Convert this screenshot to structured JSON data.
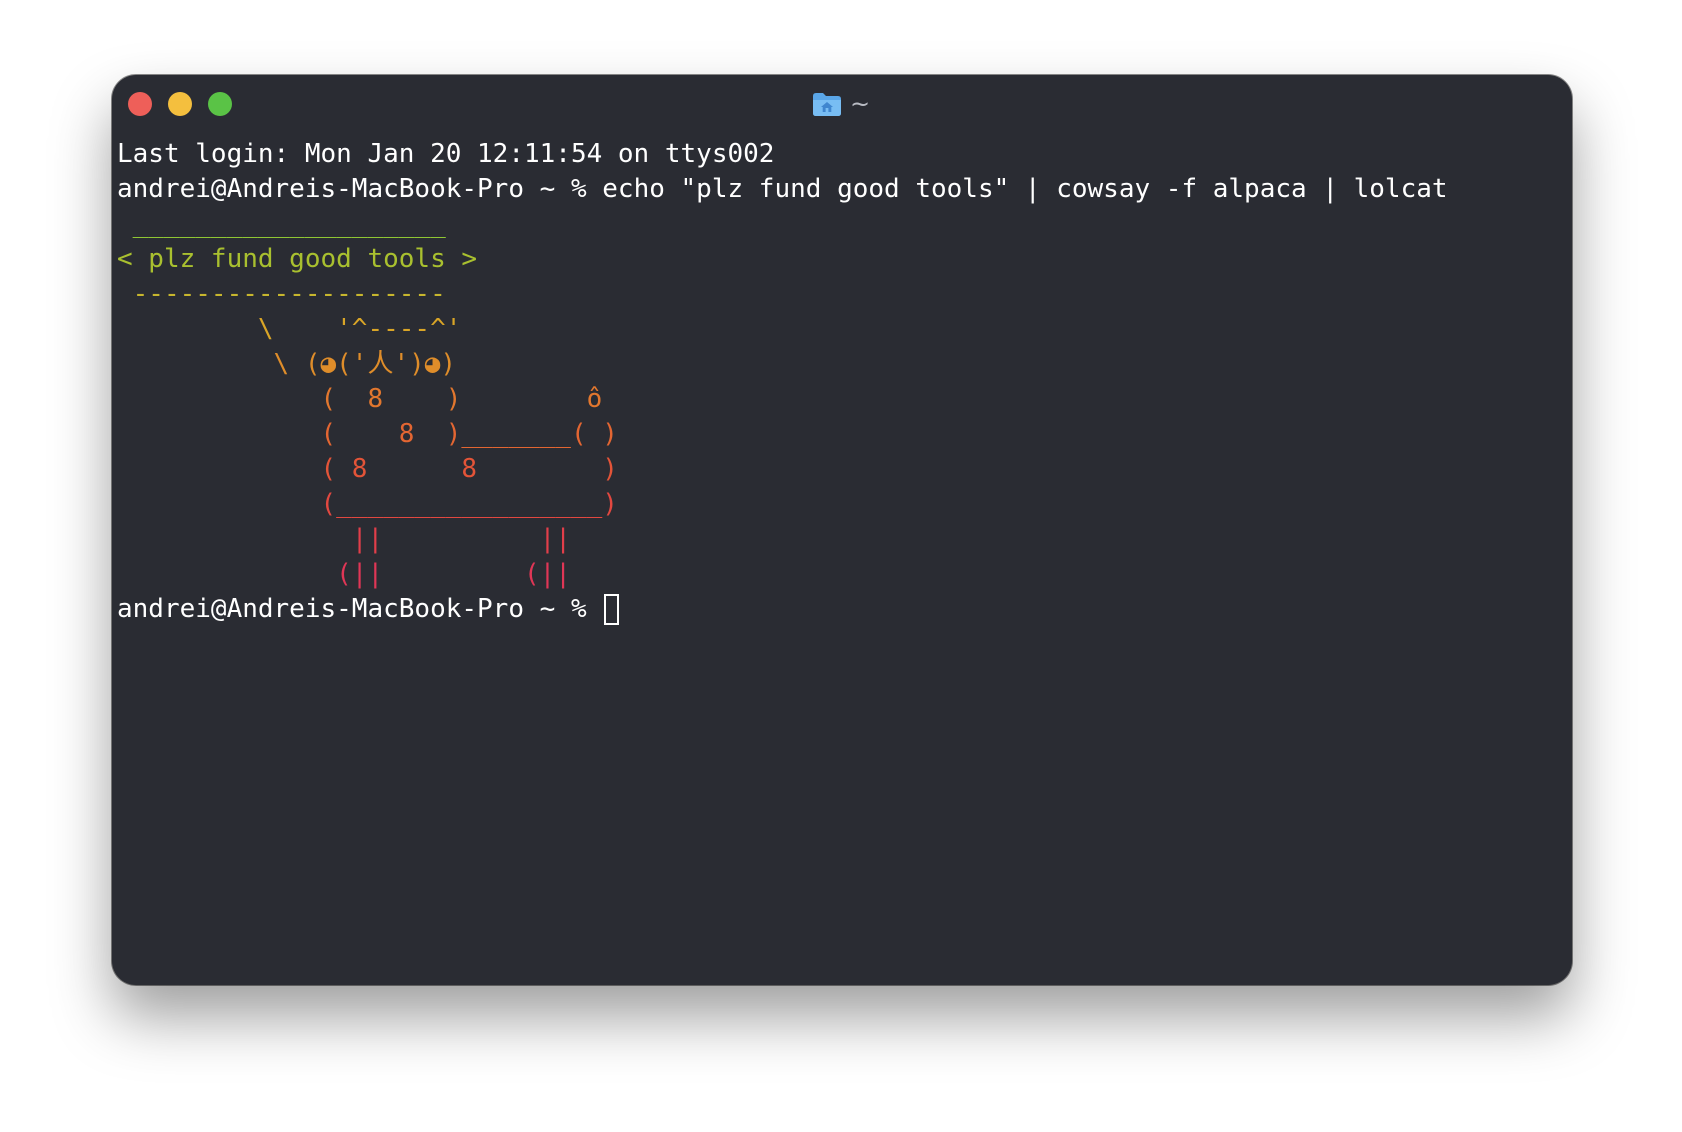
{
  "window": {
    "title": "~",
    "background": "#2a2c33",
    "traffic_lights": [
      "#ee5f59",
      "#f4bf3e",
      "#5ac346"
    ]
  },
  "terminal": {
    "last_login": "Last login: Mon Jan 20 12:11:54 on ttys002",
    "prompt": "andrei@Andreis-MacBook-Pro ~ %",
    "command": "echo \"plz fund good tools\" | cowsay -f alpaca | lolcat",
    "output_lines": [
      " ____________________",
      "< plz fund good tools >",
      " --------------------",
      "         \\    '^----^'",
      "          \\ (◕('人')◕)",
      "             (  8    )        ô",
      "             (    8  )_______( )",
      "             ( 8      8        )",
      "             (_________________)",
      "               ||          ||",
      "              (||         (||"
    ],
    "output_colors": [
      "#8fc734",
      "#a9c02f",
      "#c7b62e",
      "#d9a527",
      "#df8d2a",
      "#e2772e",
      "#e36632",
      "#e35438",
      "#e24840",
      "#e23e4a",
      "#e03656"
    ],
    "text_color": "#ffffff"
  }
}
